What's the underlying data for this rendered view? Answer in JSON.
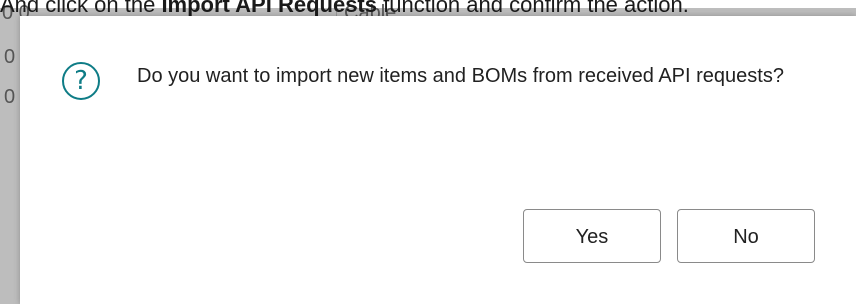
{
  "background": {
    "instruction_prefix": "And click on the ",
    "instruction_bold": "Import API Requests",
    "instruction_suffix": " function and confirm the action.",
    "cell_top_left": "0 0",
    "cell_top_mid": "Cable",
    "row_markers": [
      "0",
      "0"
    ]
  },
  "dialog": {
    "icon": "question-mark-icon",
    "icon_glyph": "?",
    "message": "Do you want to import new items and BOMs from received API requests?",
    "buttons": {
      "yes_label": "Yes",
      "no_label": "No"
    },
    "colors": {
      "accent": "#0e7c86",
      "button_border": "#8a8a8a"
    }
  }
}
